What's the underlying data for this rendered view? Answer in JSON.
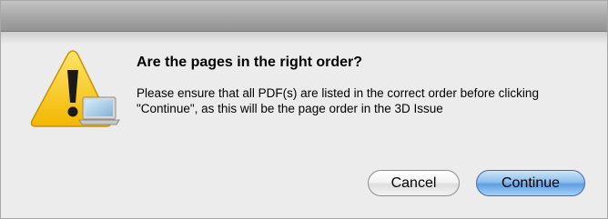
{
  "dialog": {
    "title": "Are the pages in the right order?",
    "message": "Please ensure that all PDF(s) are listed in the correct order before clicking \"Continue\", as this will be the page order in the 3D Issue",
    "icon": "warning-icon",
    "buttons": {
      "cancel_label": "Cancel",
      "continue_label": "Continue"
    }
  },
  "colors": {
    "warning_yellow": "#f5c518",
    "default_button_blue": "#5fa0e4"
  }
}
